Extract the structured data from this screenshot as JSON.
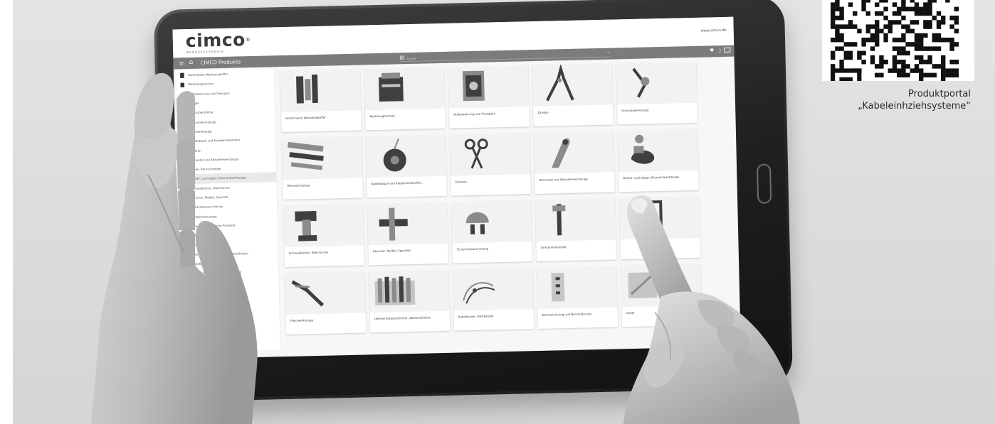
{
  "site": {
    "logo_word": "cimco",
    "logo_mark": "®",
    "logo_sub": "WERKZEUGFABRIK",
    "url": "www.cimco.de"
  },
  "nav": {
    "menu_icon": "hamburger-menu-icon",
    "home_icon": "home-icon",
    "title": "CIMCO Produkte",
    "search_placeholder": "Suche",
    "favorites_icon": "heart-icon",
    "document_icon": "document-icon",
    "account_icon": "id-card-icon"
  },
  "sidebar": {
    "items": [
      {
        "label": "Hartschalen Werkzeugkoffer",
        "icon": "case-icon"
      },
      {
        "label": "Werkzeugtaschen",
        "icon": "bag-icon"
      },
      {
        "label": "Aufbewahrung und Transport",
        "icon": "storage-icon"
      },
      {
        "label": "Zangen",
        "icon": "pliers-icon"
      },
      {
        "label": "Schraubendreher",
        "icon": "screwdriver-icon"
      },
      {
        "label": "Schraubwerkzeuge",
        "icon": "wrench-icon"
      },
      {
        "label": "Messwerkzeuge",
        "icon": "measure-icon"
      },
      {
        "label": "Kabelabspul und Kabeleinziehhilfen",
        "icon": "cable-reel-icon"
      },
      {
        "label": "Scheren",
        "icon": "scissors-icon"
      },
      {
        "label": "Abmantel und Abisolierwerkzeuge",
        "icon": "stripper-icon"
      },
      {
        "label": "Sägen, Rohrschneider",
        "icon": "saw-icon"
      },
      {
        "label": "Bohrer, Lochsägen, Diamantwerkzeuge",
        "icon": "drill-bit-icon"
      },
      {
        "label": "Schraubbohrer, Blechlocher",
        "icon": "drill-icon"
      },
      {
        "label": "Hämmer, Meißel, Spachtel",
        "icon": "hammer-icon"
      },
      {
        "label": "Sicherheitsausrüstung",
        "icon": "helmet-icon"
      },
      {
        "label": "Sanitärwerkzeuge",
        "icon": "pipe-wrench-icon"
      },
      {
        "label": "Löten und chemische Produkte",
        "icon": "solder-icon"
      },
      {
        "label": "Betriebsausstattung",
        "icon": "equipment-icon"
      },
      {
        "label": "Presswerkzeuge",
        "icon": "crimp-icon"
      },
      {
        "label": "Lötfreie Kabelverbinder, Aderendhülsen",
        "icon": "connector-icon"
      },
      {
        "label": "Kabelbinder, Klettbänder",
        "icon": "cable-tie-icon"
      },
      {
        "label": "Kennzeichnung und Beschilderung",
        "icon": "label-icon"
      },
      {
        "label": "Schrauben",
        "icon": "screw-icon"
      },
      {
        "label": "Isolieren und Verbinder",
        "icon": "insulation-icon"
      }
    ],
    "active_index": 11
  },
  "products": [
    {
      "label": "Hartschalen Werkzeugkoffer",
      "icon": "tool-case-image"
    },
    {
      "label": "Werkzeugtaschen",
      "icon": "tool-bag-image"
    },
    {
      "label": "Aufbewahrung und Transport",
      "icon": "storage-box-image"
    },
    {
      "label": "Zangen",
      "icon": "pliers-image"
    },
    {
      "label": "Schraubwerkzeuge",
      "icon": "screw-tools-image"
    },
    {
      "label": "Messwerkzeuge",
      "icon": "measuring-tools-image"
    },
    {
      "label": "Kabelabspul und Kabeleinziehhilfen",
      "icon": "cable-reel-image"
    },
    {
      "label": "Scheren",
      "icon": "scissors-image"
    },
    {
      "label": "Abmantel und Abisolierwerkzeuge",
      "icon": "stripping-tool-image"
    },
    {
      "label": "Bohrer, Lochsägen, Diamantwerkzeuge",
      "icon": "hole-saw-image"
    },
    {
      "label": "Schraubbohrer, Blechlocher",
      "icon": "cordless-drill-image"
    },
    {
      "label": "Hämmer, Meißel, Spachtel",
      "icon": "hammer-image"
    },
    {
      "label": "Sicherheitsausrüstung",
      "icon": "safety-helmet-image"
    },
    {
      "label": "Sanitärwerkzeuge",
      "icon": "pipe-wrench-image"
    },
    {
      "label": "",
      "icon": "clamp-image"
    },
    {
      "label": "Presswerkzeuge",
      "icon": "crimping-pliers-image"
    },
    {
      "label": "Lötfreie Kabelverbinder, Aderendhülsen",
      "icon": "cable-connectors-image"
    },
    {
      "label": "Kabelbinder, Klettbänder",
      "icon": "cable-ties-image"
    },
    {
      "label": "Kennzeichnung und Beschilderung",
      "icon": "marking-image"
    },
    {
      "label": "Isolier",
      "icon": "insulation-image"
    }
  ],
  "qr": {
    "caption_line1": "Produktportal",
    "caption_line2": "„Kabeleinhziehsysteme“"
  },
  "colors": {
    "navbar": "#7b7c7d",
    "background": "#e0e1e2",
    "tablet_frame": "#2a2b2c"
  }
}
